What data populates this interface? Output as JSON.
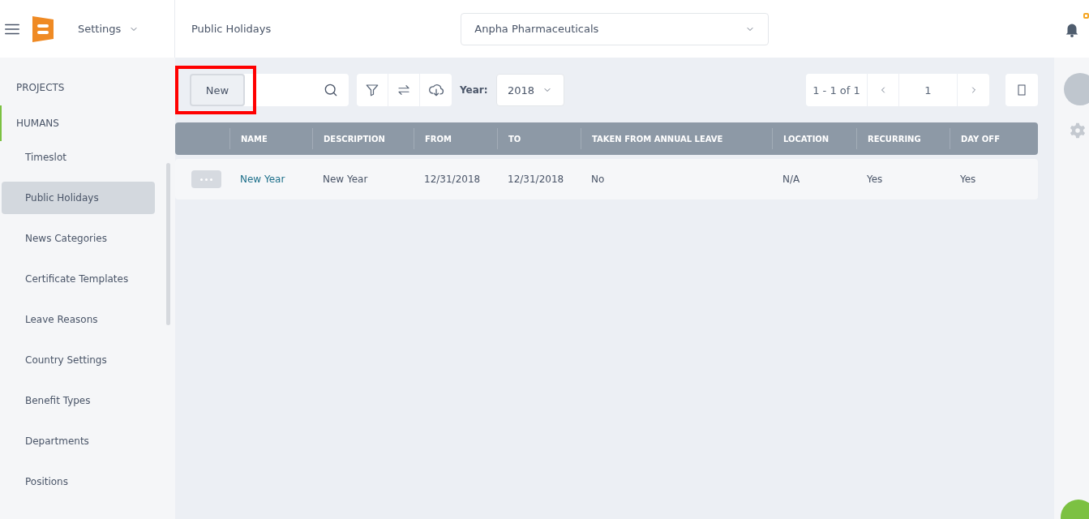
{
  "header": {
    "module": "Settings",
    "page_title": "Public Holidays",
    "company": "Anpha Pharmaceuticals",
    "notification_badge": true
  },
  "sidebar": {
    "sections": [
      {
        "label": "PROJECTS",
        "expanded": false
      },
      {
        "label": "HUMANS",
        "expanded": true,
        "children": [
          {
            "label": "Timeslot",
            "selected": false
          },
          {
            "label": "Public Holidays",
            "selected": true
          },
          {
            "label": "News Categories",
            "selected": false
          },
          {
            "label": "Certificate Templates",
            "selected": false
          },
          {
            "label": "Leave Reasons",
            "selected": false
          },
          {
            "label": "Country Settings",
            "selected": false
          },
          {
            "label": "Benefit Types",
            "selected": false
          },
          {
            "label": "Departments",
            "selected": false
          },
          {
            "label": "Positions",
            "selected": false
          }
        ]
      }
    ]
  },
  "toolbar": {
    "new_button": "New",
    "year_label": "Year:",
    "year": "2018",
    "pagination": "1 - 1 of 1",
    "page": "1"
  },
  "table": {
    "columns": [
      "NAME",
      "DESCRIPTION",
      "FROM",
      "TO",
      "TAKEN FROM ANNUAL LEAVE",
      "LOCATION",
      "RECURRING",
      "DAY OFF"
    ],
    "rows": [
      {
        "cells": [
          "New Year",
          "New Year",
          "12/31/2018",
          "12/31/2018",
          "No",
          "N/A",
          "Yes",
          "Yes"
        ]
      }
    ]
  }
}
